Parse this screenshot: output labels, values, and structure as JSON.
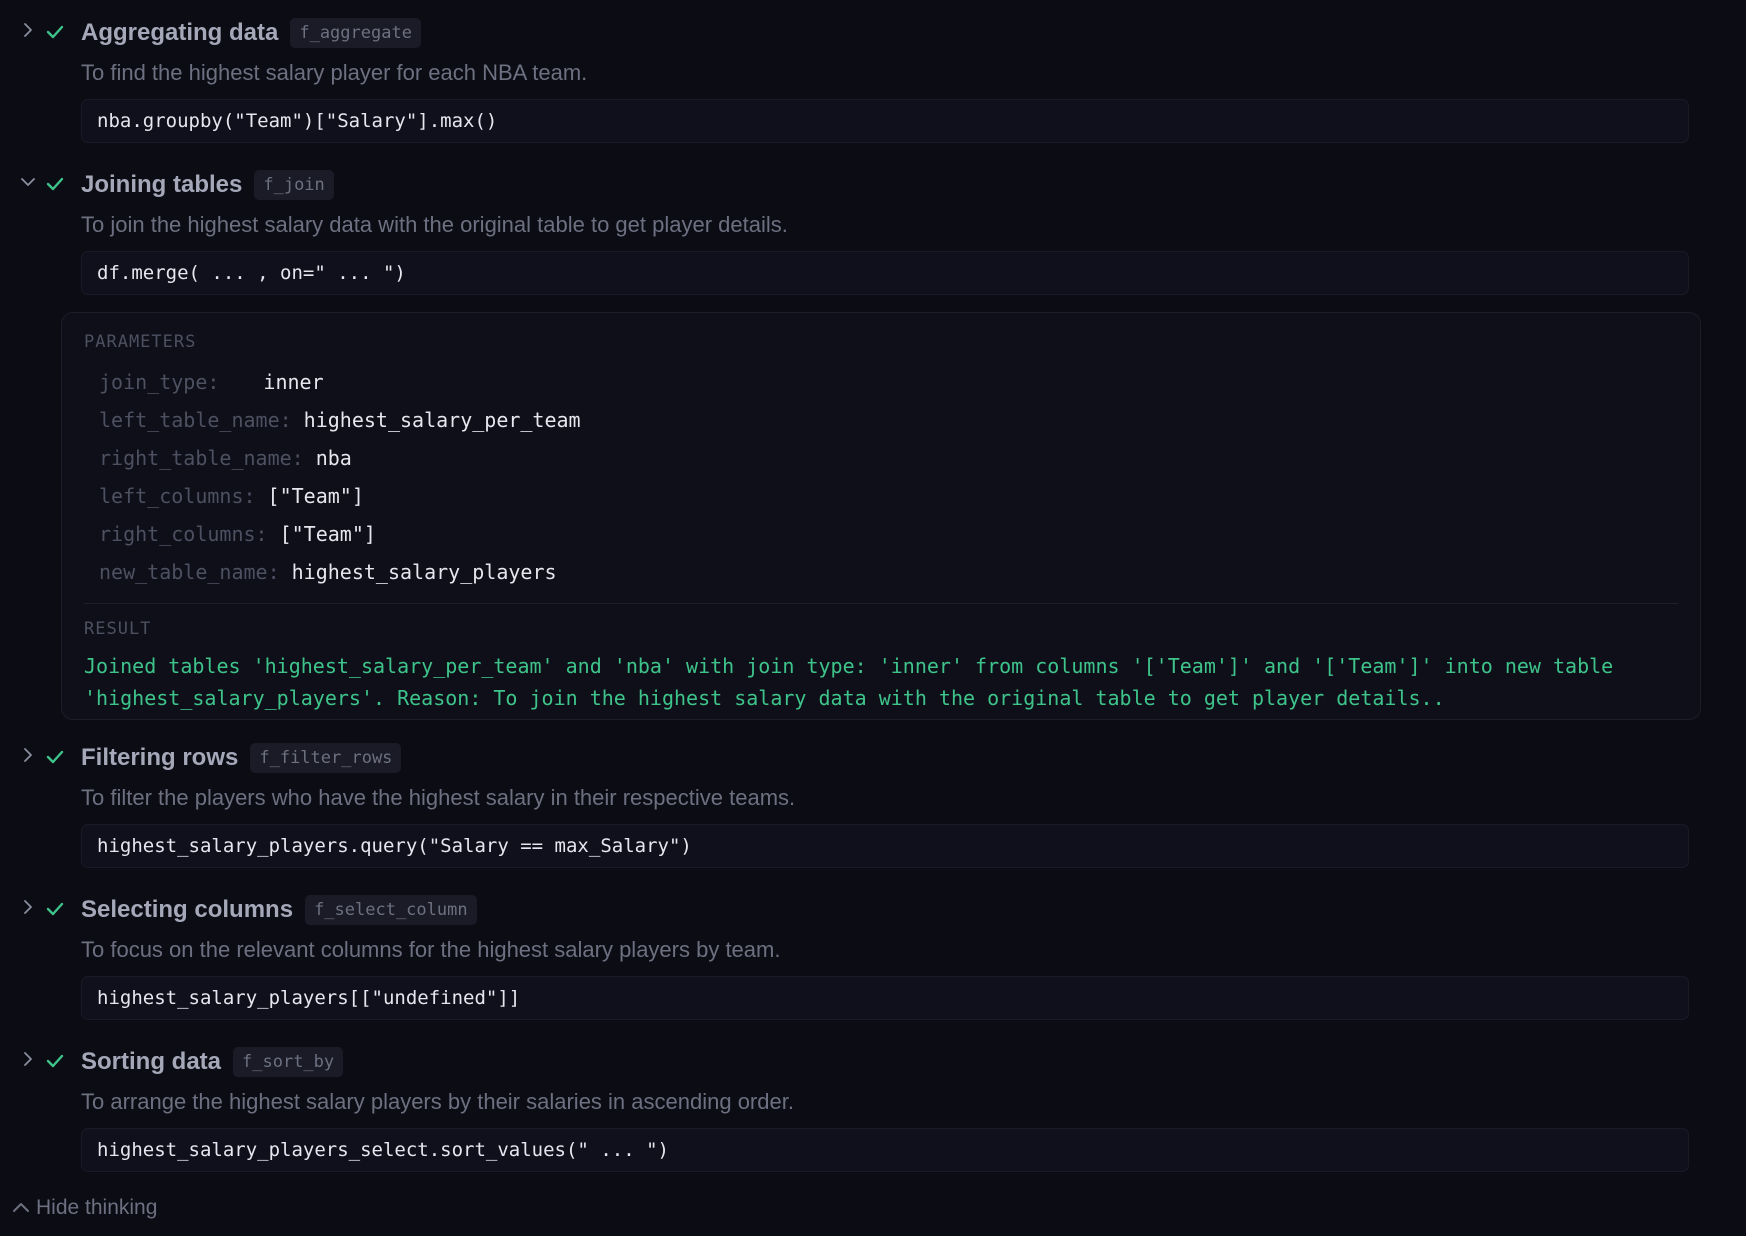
{
  "colors": {
    "background": "#0c0c14",
    "check": "#3ec48a",
    "result": "#3ec48a",
    "muted": "#6c7080",
    "title": "#a4a8b8"
  },
  "steps": [
    {
      "title": "Aggregating data",
      "function": "f_aggregate",
      "description": "To find the highest salary player for each NBA team.",
      "code": "nba.groupby(\"Team\")[\"Salary\"].max()",
      "expanded": false,
      "chevron_icon": "chevron-right-icon",
      "status_icon": "check-icon"
    },
    {
      "title": "Joining tables",
      "function": "f_join",
      "description": "To join the highest salary data with the original table to get player details.",
      "code": "df.merge( ... , on=\" ... \")",
      "expanded": true,
      "chevron_icon": "chevron-down-icon",
      "status_icon": "check-icon",
      "details": {
        "parameters_label": "PARAMETERS",
        "parameters": [
          {
            "key": "join_type:",
            "value": "inner"
          },
          {
            "key": "left_table_name:",
            "value": "highest_salary_per_team"
          },
          {
            "key": "right_table_name:",
            "value": "nba"
          },
          {
            "key": "left_columns:",
            "value": "[\"Team\"]"
          },
          {
            "key": "right_columns:",
            "value": "[\"Team\"]"
          },
          {
            "key": "new_table_name:",
            "value": "highest_salary_players"
          }
        ],
        "result_label": "RESULT",
        "result": "Joined tables 'highest_salary_per_team' and 'nba' with join type: 'inner' from columns '['Team']' and '['Team']' into new table 'highest_salary_players'. Reason: To join the highest salary data with the original table to get player details.."
      }
    },
    {
      "title": "Filtering rows",
      "function": "f_filter_rows",
      "description": "To filter the players who have the highest salary in their respective teams.",
      "code": "highest_salary_players.query(\"Salary == max_Salary\")",
      "expanded": false,
      "chevron_icon": "chevron-right-icon",
      "status_icon": "check-icon"
    },
    {
      "title": "Selecting columns",
      "function": "f_select_column",
      "description": "To focus on the relevant columns for the highest salary players by team.",
      "code": "highest_salary_players[[\"undefined\"]]",
      "expanded": false,
      "chevron_icon": "chevron-right-icon",
      "status_icon": "check-icon"
    },
    {
      "title": "Sorting data",
      "function": "f_sort_by",
      "description": "To arrange the highest salary players by their salaries in ascending order.",
      "code": "highest_salary_players_select.sort_values(\" ... \")",
      "expanded": false,
      "chevron_icon": "chevron-right-icon",
      "status_icon": "check-icon"
    }
  ],
  "footer": {
    "hide_thinking_label": "Hide thinking",
    "icon": "chevron-up-icon"
  }
}
